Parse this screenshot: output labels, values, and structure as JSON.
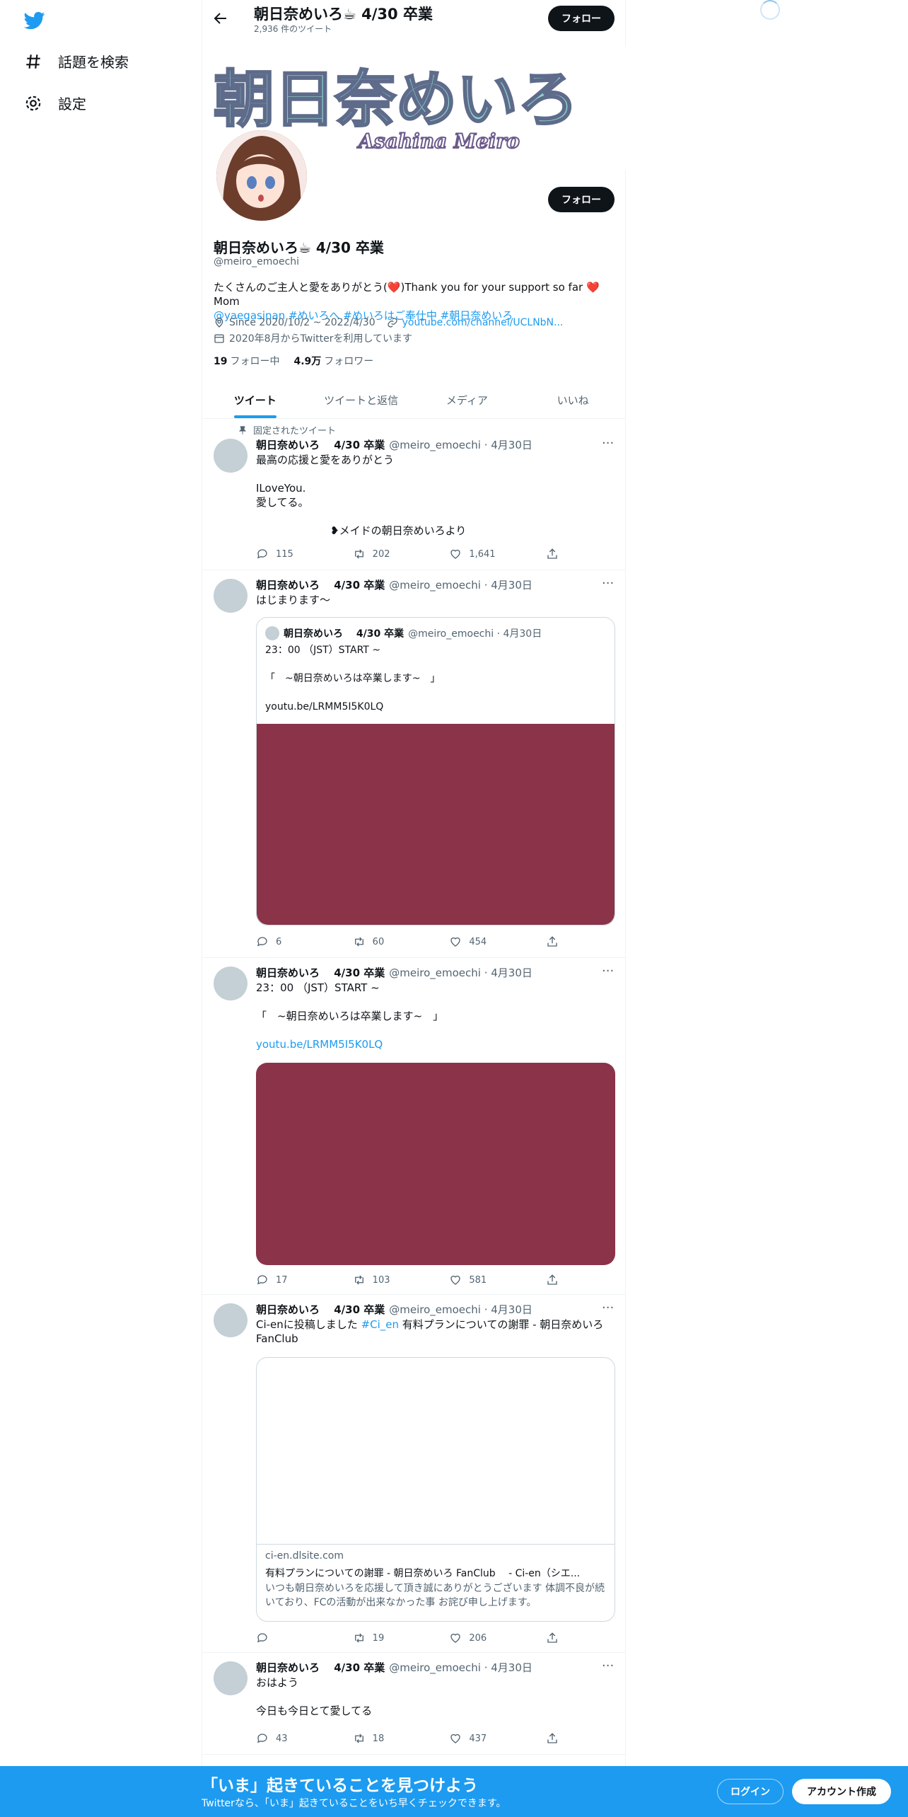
{
  "sidebar": {
    "items": [
      {
        "label": "話題を検索",
        "icon": "hashtag-icon"
      },
      {
        "label": "設定",
        "icon": "gear-icon"
      }
    ]
  },
  "header": {
    "title": "朝日奈めいろ☕ 4/30 卒業",
    "tweet_count": "2,936 件のツイート",
    "follow_label": "フォロー"
  },
  "profile": {
    "banner_title": "朝日奈めいろ",
    "banner_subtitle": "Asahina Meiro",
    "name": "朝日奈めいろ☕ 4/30 卒業",
    "handle": "@meiro_emoechi",
    "follow_label": "フォロー",
    "bio_text": "たくさんのご主人と愛をありがとう(❤️)Thank you for your support so far ❤️Mom",
    "bio_links": "@yaegasinan #めいろへ #めいろはご奉仕中 #朝日奈めいろ",
    "location": "Since 2020/10/2 ~ 2022/4/30",
    "url": "youtube.com/channel/UCLNbN...",
    "joined": "2020年8月からTwitterを利用しています",
    "following_count": "19",
    "following_label": "フォロー中",
    "followers_count": "4.9万",
    "followers_label": "フォロワー"
  },
  "tabs": [
    "ツイート",
    "ツイートと返信",
    "メディア",
    "いいね"
  ],
  "tweets": [
    {
      "pinned_label": "固定されたツイート",
      "name": "朝日奈めいろ　 4/30 卒業",
      "meta": "@meiro_emoechi · 4月30日",
      "text": "最高の応援と愛をありがとう\n\nILoveYou.\n愛してる。\n\n　　　　　　　❥メイドの朝日奈めいろより",
      "replies": "115",
      "retweets": "202",
      "likes": "1,641"
    },
    {
      "name": "朝日奈めいろ　 4/30 卒業",
      "meta": "@meiro_emoechi · 4月30日",
      "text": "はじまります〜",
      "quote": {
        "name": "朝日奈めいろ　 4/30 卒業",
        "meta": "@meiro_emoechi · 4月30日",
        "text": "23：00 （JST）START ~\n\n「　~朝日奈めいろは卒業します~　」\n\nyoutu.be/LRMM5I5K0LQ"
      },
      "replies": "6",
      "retweets": "60",
      "likes": "454"
    },
    {
      "name": "朝日奈めいろ　 4/30 卒業",
      "meta": "@meiro_emoechi · 4月30日",
      "text": "23：00 （JST）START ~\n\n「　~朝日奈めいろは卒業します~　」",
      "link": "youtu.be/LRMM5I5K0LQ",
      "replies": "17",
      "retweets": "103",
      "likes": "581"
    },
    {
      "name": "朝日奈めいろ　 4/30 卒業",
      "meta": "@meiro_emoechi · 4月30日",
      "text_pre": "Ci-enに投稿しました ",
      "text_tag": "#Ci_en",
      "text_post": " 有料プランについての謝罪 - 朝日奈めいろ FanClub",
      "card": {
        "domain": "ci-en.dlsite.com",
        "title": "有料プランについての謝罪 - 朝日奈めいろ FanClub　 - Ci-en（シエ...",
        "desc": "いつも朝日奈めいろを応援して頂き誠にありがとうございます 体調不良が続いており、FCの活動が出来なかった事 お詫び申し上げます。"
      },
      "replies": "",
      "retweets": "19",
      "likes": "206"
    },
    {
      "name": "朝日奈めいろ　 4/30 卒業",
      "meta": "@meiro_emoechi · 4月30日",
      "text": "おはよう\n\n今日も今日とて愛してる",
      "replies": "43",
      "retweets": "18",
      "likes": "437"
    }
  ],
  "bottom_bar": {
    "title": "「いま」起きていることを見つけよう",
    "subtitle": "Twitterなら、「いま」起きていることをいち早くチェックできます。",
    "login": "ログイン",
    "signup": "アカウント作成"
  },
  "colors": {
    "accent": "#1d9bf0",
    "media": "#8a3349",
    "follow_btn": "#0f1419"
  }
}
